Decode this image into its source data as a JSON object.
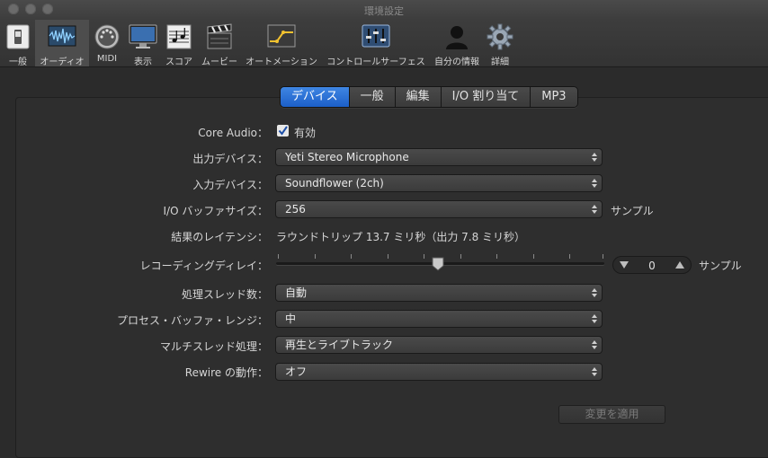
{
  "window": {
    "title": "環境設定"
  },
  "toolbar": {
    "items": [
      {
        "label": "一般",
        "icon": "switch-icon"
      },
      {
        "label": "オーディオ",
        "icon": "audio-waveform-icon",
        "selected": true
      },
      {
        "label": "MIDI",
        "icon": "midi-connector-icon"
      },
      {
        "label": "表示",
        "icon": "display-monitor-icon"
      },
      {
        "label": "スコア",
        "icon": "score-notes-icon"
      },
      {
        "label": "ムービー",
        "icon": "clapperboard-icon"
      },
      {
        "label": "オートメーション",
        "icon": "automation-curve-icon"
      },
      {
        "label": "コントロールサーフェス",
        "icon": "mixer-faders-icon"
      },
      {
        "label": "自分の情報",
        "icon": "user-silhouette-icon"
      },
      {
        "label": "詳細",
        "icon": "gear-icon"
      }
    ]
  },
  "tabs": [
    {
      "label": "デバイス",
      "active": true
    },
    {
      "label": "一般"
    },
    {
      "label": "編集"
    },
    {
      "label": "I/O 割り当て"
    },
    {
      "label": "MP3"
    }
  ],
  "settings": {
    "core_audio": {
      "label": "Core Audio：",
      "checkbox_label": "有効",
      "checked": true
    },
    "output_device": {
      "label": "出力デバイス：",
      "value": "Yeti Stereo Microphone"
    },
    "input_device": {
      "label": "入力デバイス：",
      "value": "Soundflower (2ch)"
    },
    "io_buffer": {
      "label": "I/O バッファサイズ：",
      "value": "256",
      "unit": "サンプル"
    },
    "latency": {
      "label": "結果のレイテンシ：",
      "value": "ラウンドトリップ 13.7 ミリ秒（出力 7.8 ミリ秒）"
    },
    "recording_delay": {
      "label": "レコーディングディレイ：",
      "value": "0",
      "unit": "サンプル",
      "slider_fraction": 0.5
    },
    "process_threads": {
      "label": "処理スレッド数：",
      "value": "自動"
    },
    "process_buffer": {
      "label": "プロセス・バッファ・レンジ：",
      "value": "中"
    },
    "multithreading": {
      "label": "マルチスレッド処理：",
      "value": "再生とライブトラック"
    },
    "rewire": {
      "label": "Rewire の動作：",
      "value": "オフ"
    }
  },
  "apply_button": {
    "label": "変更を適用",
    "enabled": false
  },
  "colors": {
    "accent": "#1c5fc8",
    "background": "#2b2b2b"
  }
}
